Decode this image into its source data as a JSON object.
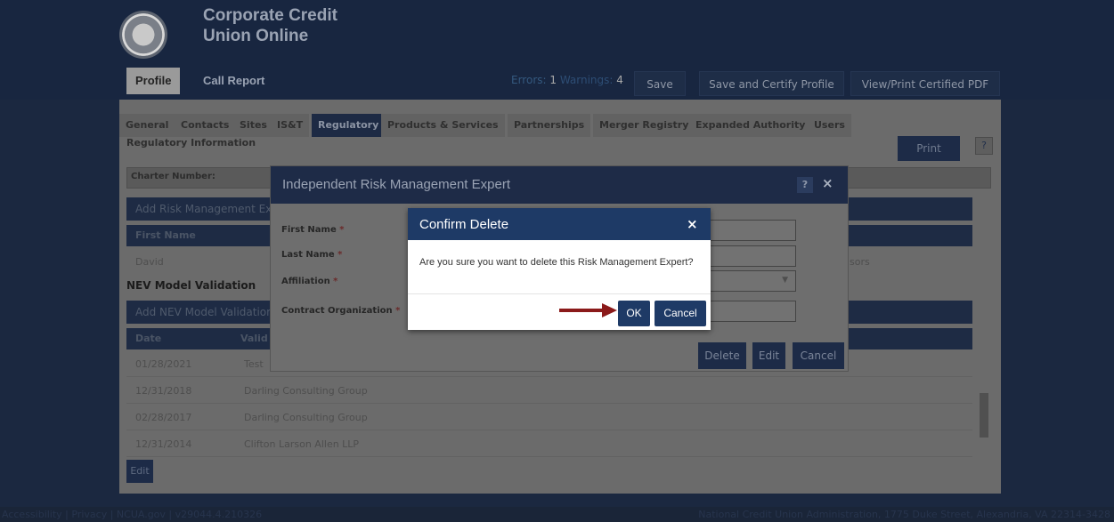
{
  "app": {
    "title_line1": "Corporate Credit",
    "title_line2": "Union Online",
    "nav": [
      "Profile",
      "Call Report"
    ],
    "status": {
      "errors_label": "Errors: ",
      "errors": "1",
      "warnings_label": " Warnings: ",
      "warnings": "4"
    },
    "header_buttons": [
      "Save",
      "Save and Certify Profile",
      "View/Print Certified PDF"
    ]
  },
  "tabs": [
    "General",
    "Contacts",
    "Sites",
    "IS&T",
    "Regulatory",
    "Products & Services",
    "Partnerships",
    "Merger Registry",
    "Expanded Authority",
    "Users"
  ],
  "active_tab": "Regulatory",
  "page": {
    "section_label": "Regulatory Information",
    "print_label": "Print",
    "help_label": "?",
    "charter_label": "Charter Number:",
    "rme_add_label": "Add Risk Management Ex",
    "rme_col": "First Name",
    "rme_row": "David",
    "rme_row_right": "sors",
    "nev_title": "NEV Model Validation",
    "nev_add_label": "Add NEV Model Validation",
    "nev_cols": [
      "Date",
      "Valid"
    ],
    "nev_rows": [
      {
        "date": "01/28/2021",
        "name": "Test"
      },
      {
        "date": "12/31/2018",
        "name": "Darling Consulting Group"
      },
      {
        "date": "02/28/2017",
        "name": "Darling Consulting Group"
      },
      {
        "date": "12/31/2014",
        "name": "Clifton Larson Allen LLP"
      }
    ],
    "edit_label": "Edit"
  },
  "modal": {
    "title": "Independent Risk Management Expert",
    "help": "?",
    "close": "×",
    "fields": [
      "First Name",
      "Last Name",
      "Affiliation",
      "Contract Organization"
    ],
    "required_mark": " *",
    "buttons": [
      "Delete",
      "Edit",
      "Cancel"
    ]
  },
  "confirm": {
    "title": "Confirm Delete",
    "close": "×",
    "message": "Are you sure you want to delete this Risk Management Expert?",
    "ok": "OK",
    "cancel": "Cancel"
  },
  "footer": {
    "left": "Accessibility | Privacy | NCUA.gov | v29044.4.210326",
    "right": "National Credit Union Administration, 1775 Duke Street, Alexandria, VA 22314-3428"
  },
  "colors": {
    "primary": "#1e3a66",
    "annotation_arrow": "#8b1a1a"
  }
}
